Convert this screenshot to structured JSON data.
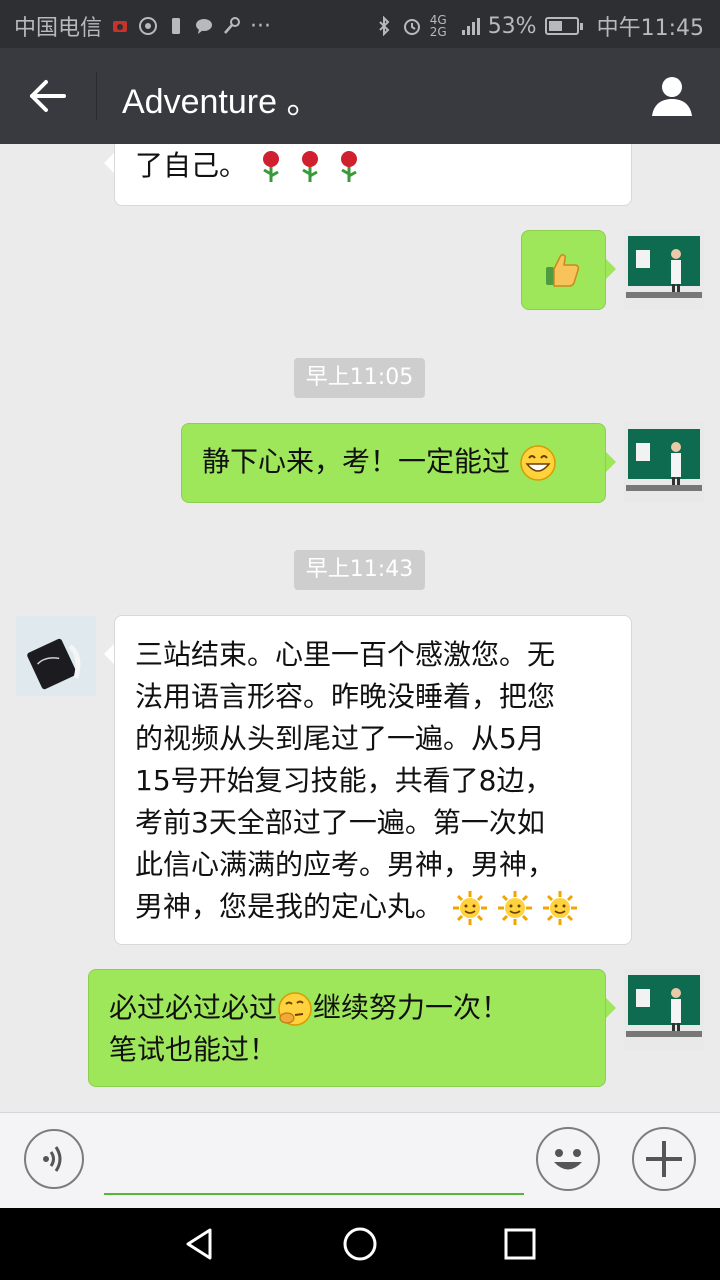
{
  "status_bar": {
    "carrier": "中国电信",
    "network": "4G 2G",
    "battery_percent": "53%",
    "time": "中午11:45",
    "battery_level": 0.53
  },
  "header": {
    "title": "Adventure 。"
  },
  "messages": [
    {
      "side": "left",
      "text": "了自己。",
      "emoji": "rose-icon x3"
    },
    {
      "side": "right",
      "text": "",
      "emoji": "thumbs-up-icon"
    },
    {
      "time": "早上11:05"
    },
    {
      "side": "right",
      "text": "静下心来，考！一定能过",
      "emoji": "grin-icon"
    },
    {
      "time": "早上11:43"
    },
    {
      "side": "left",
      "text": "三站结束。心里一百个感激您。无法用语言形容。昨晚没睡着，把您的视频从头到尾过了一遍。从5月15号开始复习技能，共看了8边，考前3天全部过了一遍。第一次如此信心满满的应考。男神，男神，男神，您是我的定心丸。",
      "emoji": "sun-icon x3"
    },
    {
      "side": "right",
      "text_a": "必过必过必过",
      "text_b": "继续努力一次！笔试也能过！",
      "emoji": "thinking-icon"
    }
  ],
  "chat": {
    "msg1_text": "了自己。",
    "time1": "早上11:05",
    "msg3_text": "静下心来，考！一定能过",
    "time2": "早上11:43",
    "msg4_line1": "三站结束。心里一百个感激您。无",
    "msg4_line2": "法用语言形容。昨晚没睡着，把您",
    "msg4_line3": "的视频从头到尾过了一遍。从5月",
    "msg4_line4": "15号开始复习技能，共看了8边，",
    "msg4_line5": "考前3天全部过了一遍。第一次如",
    "msg4_line6": "此信心满满的应考。男神，男神，",
    "msg4_line7": "男神，您是我的定心丸。",
    "msg5_part1": "必过必过必过",
    "msg5_part2": "继续努力一次！",
    "msg5_line2": "笔试也能过！"
  },
  "colors": {
    "status_bar": "#2e2f33",
    "title_bar": "#393a3f",
    "chat_bg": "#ebebeb",
    "bubble_right": "#9ee65a",
    "bubble_left": "#ffffff",
    "accent_input": "#53b83a"
  },
  "icons": {
    "back": "arrow-left-icon",
    "profile": "person-icon",
    "voice": "voice-icon",
    "emoji": "smiley-icon",
    "more": "plus-icon"
  }
}
